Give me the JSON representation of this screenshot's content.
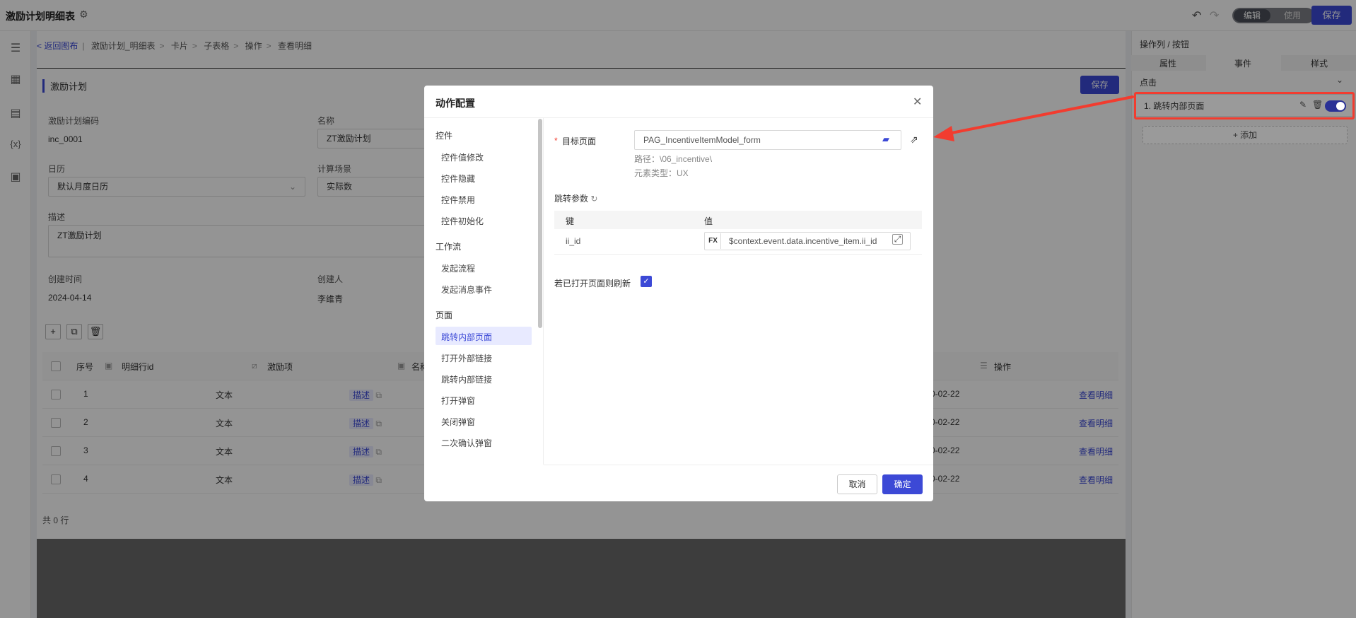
{
  "app": {
    "title": "激励计划明细表",
    "gear_icon": "gear-icon",
    "mode_edit": "编辑",
    "mode_use": "使用",
    "save": "保存"
  },
  "breadcrumb": {
    "back": "< 返回图布",
    "items": [
      "激励计划_明细表",
      "卡片",
      "子表格",
      "操作",
      "查看明细"
    ]
  },
  "form": {
    "section_title": "激励计划",
    "save": "保存",
    "fields": {
      "code_label": "激励计划编码",
      "code_value": "inc_0001",
      "name_label": "名称",
      "name_value": "ZT激励计划",
      "calendar_label": "日历",
      "calendar_value": "默认月度日历",
      "scene_label": "计算场景",
      "scene_value": "实际数",
      "desc_label": "描述",
      "desc_value": "ZT激励计划",
      "created_label": "创建时间",
      "created_value": "2024-04-14",
      "creator_label": "创建人",
      "creator_value": "李维青"
    }
  },
  "table": {
    "headers": {
      "seq": "序号",
      "line_id": "明细行id",
      "item": "激励项",
      "name": "名称",
      "ops": "操作"
    },
    "rows": [
      {
        "seq": "1",
        "text": "文本",
        "desc": "描述",
        "date": "0-02-22",
        "action": "查看明细"
      },
      {
        "seq": "2",
        "text": "文本",
        "desc": "描述",
        "date": "0-02-22",
        "action": "查看明细"
      },
      {
        "seq": "3",
        "text": "文本",
        "desc": "描述",
        "date": "0-02-22",
        "action": "查看明细"
      },
      {
        "seq": "4",
        "text": "文本",
        "desc": "描述",
        "date": "0-02-22",
        "action": "查看明细"
      }
    ],
    "count": "共 0 行"
  },
  "right_panel": {
    "title": "操作列 / 按钮",
    "tabs": [
      "属性",
      "事件",
      "样式"
    ],
    "event": "点击",
    "action_item": "1. 跳转内部页面",
    "add": "+ 添加"
  },
  "modal": {
    "title": "动作配置",
    "groups": [
      {
        "name": "控件",
        "items": [
          "控件值修改",
          "控件隐藏",
          "控件禁用",
          "控件初始化"
        ]
      },
      {
        "name": "工作流",
        "items": [
          "发起流程",
          "发起消息事件"
        ]
      },
      {
        "name": "页面",
        "items": [
          "跳转内部页面",
          "打开外部链接",
          "跳转内部链接",
          "打开弹窗",
          "关闭弹窗",
          "二次确认弹窗"
        ]
      }
    ],
    "target_label": "目标页面",
    "target_value": "PAG_IncentiveItemModel_form",
    "path": "路径：\\06_incentive\\",
    "elem_type": "元素类型：UX",
    "jump_params": "跳转参数",
    "param_key_header": "键",
    "param_val_header": "值",
    "param_key": "ii_id",
    "fx": "FX",
    "param_val": "$context.event.data.incentive_item.ii_id",
    "refresh_label": "若已打开页面则刷新",
    "cancel": "取消",
    "ok": "确定"
  },
  "colors": {
    "accent": "#3c49d6",
    "annotation": "#f23c2f"
  }
}
